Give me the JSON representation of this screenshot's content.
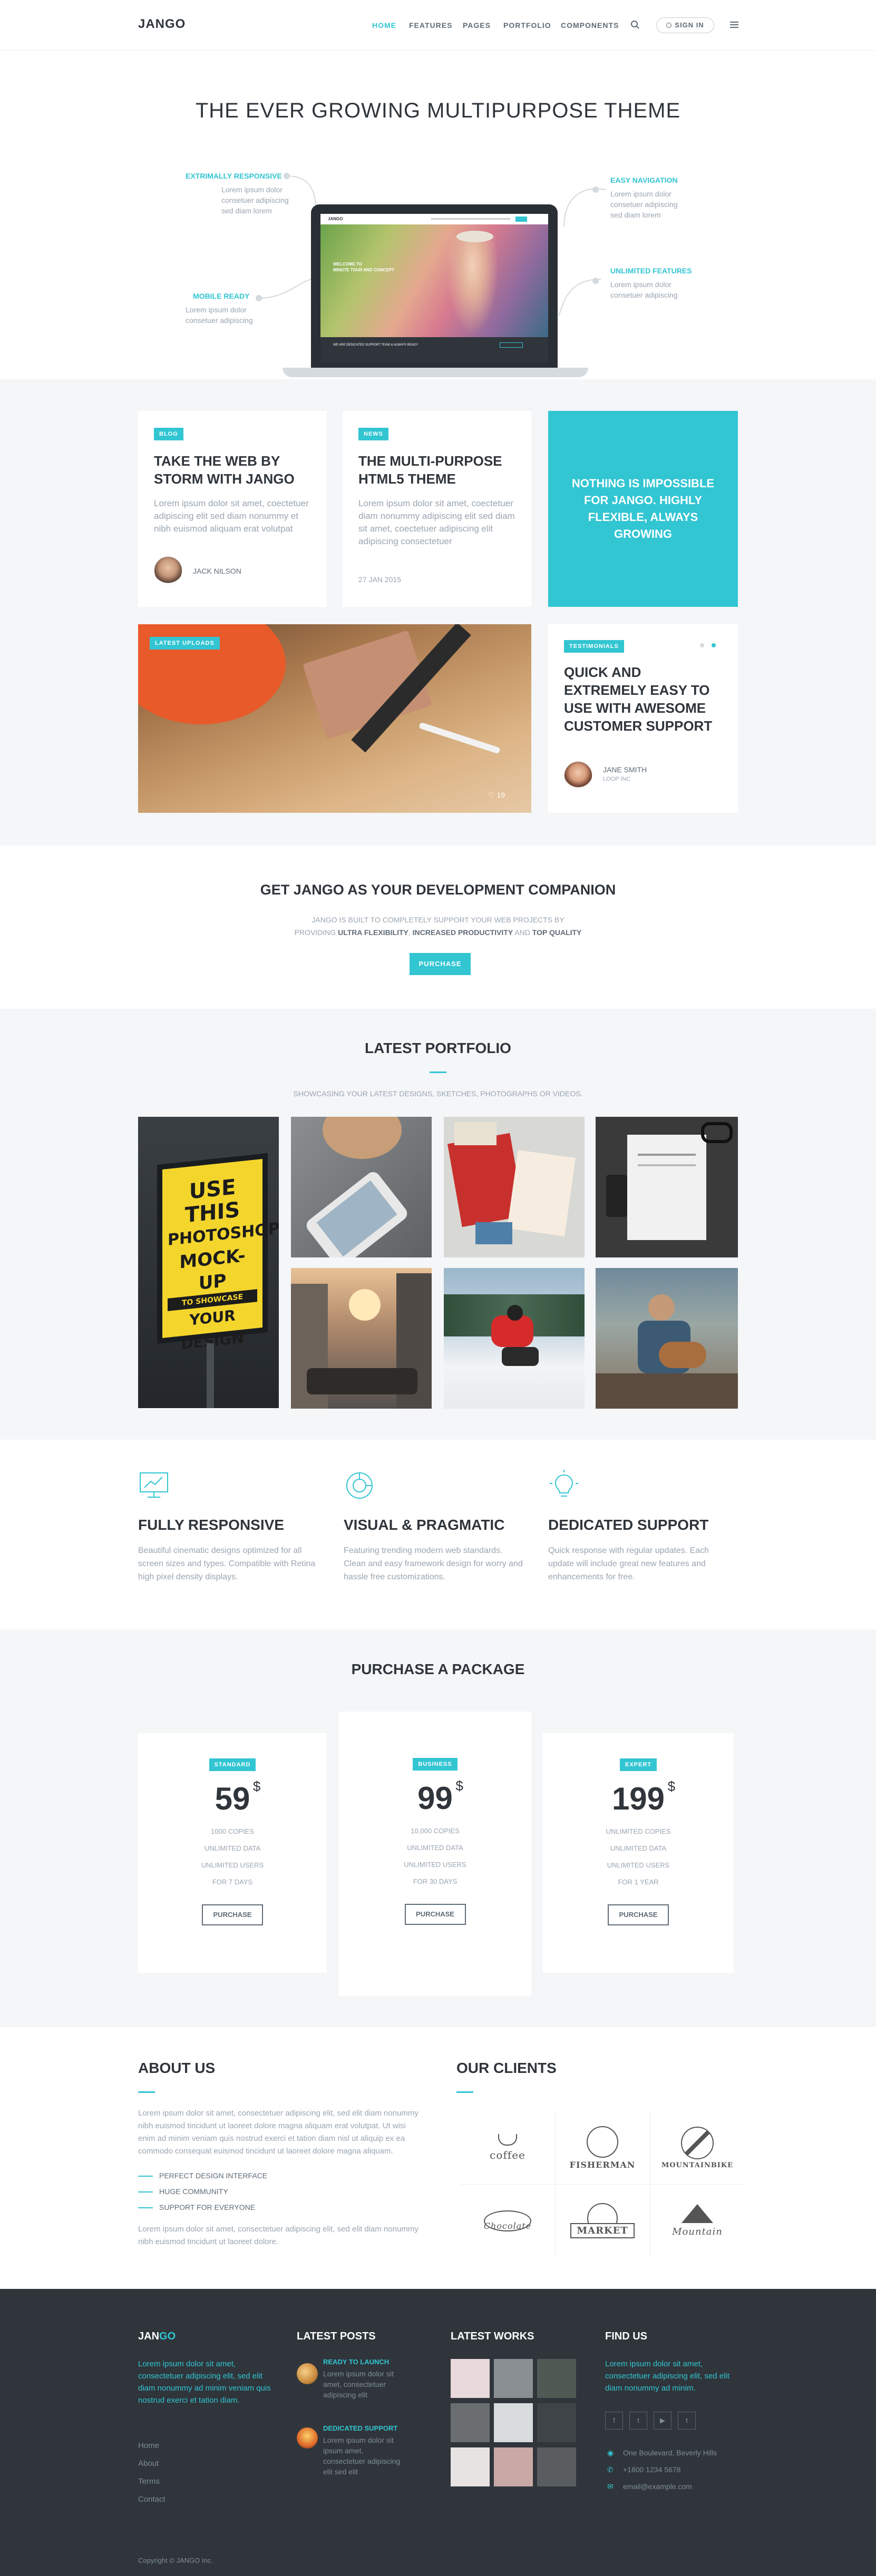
{
  "header": {
    "logo": "JANGO",
    "nav": [
      "HOME",
      "FEATURES",
      "PAGES",
      "PORTFOLIO",
      "COMPONENTS"
    ],
    "signin": "SIGN IN"
  },
  "hero": {
    "title": "THE EVER GROWING MULTIPURPOSE THEME",
    "features": [
      {
        "title": "EXTRIMALLY RESPONSIVE",
        "text": [
          "Lorem ipsum dolor",
          "consetuer adipiscing",
          "sed diam lorem"
        ]
      },
      {
        "title": "MOBILE READY",
        "text": [
          "Lorem ipsum dolor",
          "consetuer adipiscing"
        ]
      },
      {
        "title": "EASY NAVIGATION",
        "text": [
          "Lorem ipsum dolor",
          "consetuer adipiscing",
          "sed diam lorem"
        ]
      },
      {
        "title": "UNLIMITED FEATURES",
        "text": [
          "Lorem ipsum dolor",
          "consetuer adipiscing"
        ]
      }
    ],
    "screen": {
      "logo": "JANGO",
      "slide_title": "WELCOME TO\nMINUTE TOUR AND CONCEPT",
      "bottom_bar": "WE ARE DEDICATED SUPPORT TEAM & ALWAYS READY",
      "btn": "PURCHASE"
    }
  },
  "blog": {
    "card1": {
      "tag": "BLOG",
      "title": "TAKE THE WEB BY STORM WITH JANGO",
      "text": "Lorem ipsum dolor sit amet, coectetuer adipiscing elit sed diam nonummy et nibh euismod aliquam erat volutpat",
      "author": "JACK NILSON"
    },
    "card2": {
      "tag": "NEWS",
      "title": "THE MULTI-PURPOSE HTML5 THEME",
      "text": "Lorem ipsum dolor sit amet, coectetuer diam nonummy adipiscing elit sed diam sit amet, coectetuer adipiscing elit adipiscing consectetuer",
      "date": "27 JAN 2015"
    },
    "promo": "NOTHING IS IMPOSSIBLE FOR JANGO. HIGHLY FLEXIBLE, ALWAYS GROWING",
    "upload": {
      "tag": "LATEST UPLOADS",
      "likes": "19"
    },
    "testimonial": {
      "tag": "TESTIMONIALS",
      "title": "QUICK AND EXTREMELY EASY TO USE WITH AWESOME CUSTOMER SUPPORT",
      "name": "JANE SMITH",
      "company": "LOOP INC"
    }
  },
  "companion": {
    "title": "GET JANGO AS YOUR DEVELOPMENT COMPANION",
    "line1": "JANGO IS BUILT TO COMPLETELY SUPPORT YOUR WEB PROJECTS BY",
    "line2_a": "PROVIDING ",
    "line2_b": "ULTRA FLEXIBILITY",
    "line2_c": ", ",
    "line2_d": "INCREASED PRODUCTIVITY",
    "line2_e": " AND ",
    "line2_f": "TOP QUALITY",
    "button": "PURCHASE"
  },
  "portfolio": {
    "title": "LATEST PORTFOLIO",
    "subtitle": "SHOWCASING YOUR LATEST DESIGNS, SKETCHES, PHOTOGRAPHS OR VIDEOS.",
    "poster": [
      "USE THIS",
      "PHOTOSHOP",
      "MOCK-UP",
      "TO SHOWCASE",
      "YOUR",
      "DESIGN"
    ]
  },
  "features": [
    {
      "title": "FULLY RESPONSIVE",
      "text": "Beautiful cinematic designs optimized for all screen sizes and types. Compatible with Retina high pixel density displays."
    },
    {
      "title": "VISUAL & PRAGMATIC",
      "text": "Featuring trending modern web standards. Clean and easy framework design for worry and hassle free customizations."
    },
    {
      "title": "DEDICATED SUPPORT",
      "text": "Quick response with regular updates. Each update will include great new features and enhancements for free."
    }
  ],
  "pricing": {
    "title": "PURCHASE A PACKAGE",
    "plans": [
      {
        "tag": "STANDARD",
        "price": "59",
        "currency": "$",
        "features": [
          "1000 COPIES",
          "UNLIMITED DATA",
          "UNLIMITED USERS",
          "FOR 7 DAYS"
        ],
        "button": "PURCHASE"
      },
      {
        "tag": "BUSINESS",
        "price": "99",
        "currency": "$",
        "features": [
          "10,000 COPIES",
          "UNLIMITED DATA",
          "UNLIMITED USERS",
          "FOR 30 DAYS"
        ],
        "button": "PURCHASE"
      },
      {
        "tag": "EXPERT",
        "price": "199",
        "currency": "$",
        "features": [
          "UNLIMITED COPIES",
          "UNLIMITED DATA",
          "UNLIMITED USERS",
          "FOR 1 YEAR"
        ],
        "button": "PURCHASE"
      }
    ]
  },
  "about": {
    "title": "ABOUT US",
    "text1": "Lorem ipsum dolor sit amet, consectetuer adipiscing elit, sed elit diam nonummy nibh euismod tincidunt ut laoreet dolore magna aliquam erat volutpat. Ut wisi enim ad minim veniam quis nostrud exerci et tation diam nisl ut aliquip ex ea commodo consequat euismod tincidunt ut laoreet dolore magna aliquam.",
    "list": [
      "PERFECT DESIGN INTERFACE",
      "HUGE COMMUNITY",
      "SUPPORT FOR EVERYONE"
    ],
    "text2": "Lorem ipsum dolor sit amet, consectetuer adipiscing elit, sed elit diam nonummy nibh euismod tincidunt ut laoreet dolore."
  },
  "clients": {
    "title": "OUR CLIENTS",
    "logos": [
      "coffee",
      "FISHERMAN",
      "MOUNTAINBIKE",
      "Chocolate",
      "MARKET",
      "Mountain"
    ]
  },
  "footer": {
    "logo_a": "JAN",
    "logo_b": "GO",
    "about": "Lorem ipsum dolor sit amet, consectetuer adipiscing elit, sed elit diam nonummy ad minim veniam quis nostrud exerci et tation diam.",
    "links": [
      "Home",
      "About",
      "Terms",
      "Contact"
    ],
    "posts_title": "LATEST POSTS",
    "posts": [
      {
        "title": "READY TO LAUNCH",
        "text": "Lorem ipsum dolor sit amet, consectetuer adipiscing elit"
      },
      {
        "title": "DEDICATED SUPPORT",
        "text": "Lorem ipsum dolor sit ipsum amet, consectetuer adipiscing elit sed elit"
      }
    ],
    "works_title": "LATEST WORKS",
    "find_title": "FIND US",
    "find_text": "Lorem ipsum dolor sit amet, consectetuer adipiscing elit, sed elit diam nonummy ad minim.",
    "social": [
      "f",
      "t",
      "▶",
      "t"
    ],
    "address": "One Boulevard, Beverly Hills",
    "phone": "+1800 1234 5678",
    "email": "email@example.com",
    "copyright": "Copyright © JANGO Inc."
  }
}
